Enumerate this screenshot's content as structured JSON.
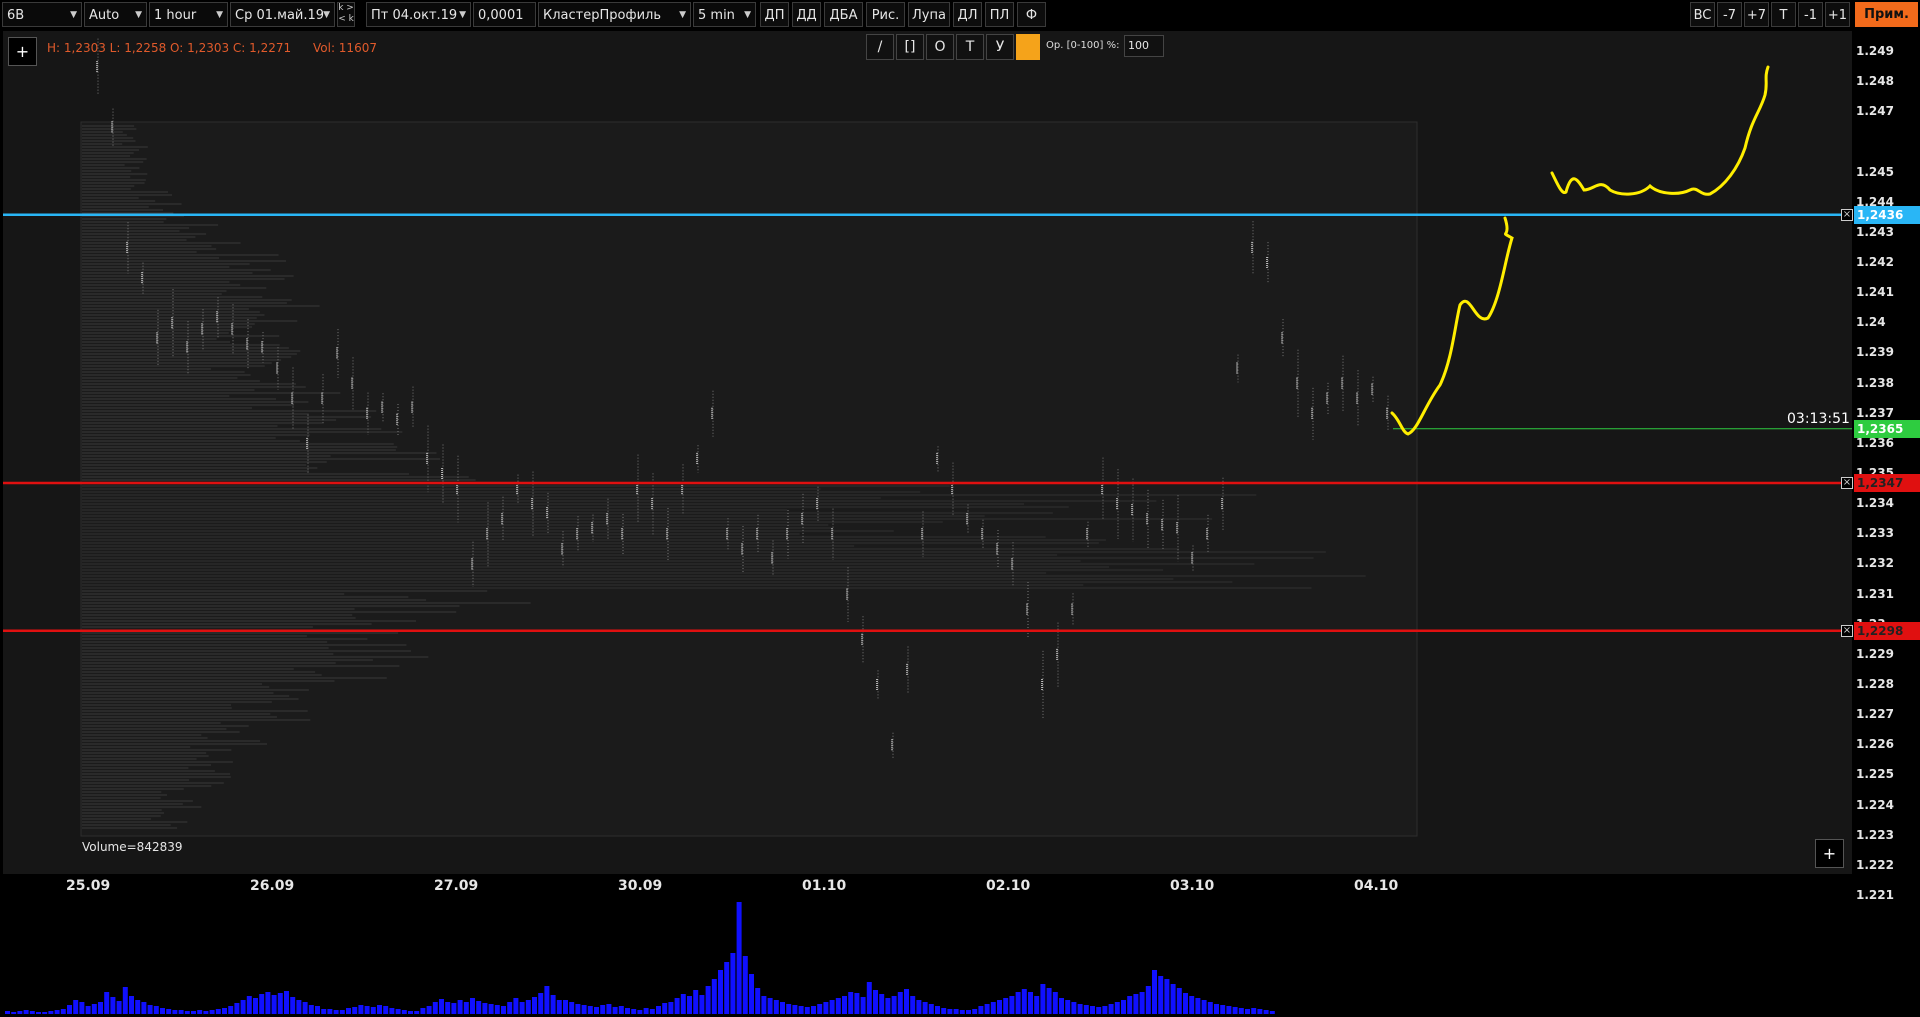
{
  "toolbar": {
    "symbol": "6B",
    "scale": "Auto",
    "timeframe": "1 hour",
    "date_from": "Ср 01.май.19",
    "k_top": "k >",
    "k_bottom": "< k",
    "date_to": "Пт 04.окт.19",
    "tick_size": "0,0001",
    "chart_type": "КластерПрофиль",
    "cluster_period": "5 min",
    "buttons": [
      "ДП",
      "ДД",
      "ДБА",
      "Рис.",
      "Лупа",
      "ДЛ",
      "ПЛ",
      "Ф"
    ],
    "right_buttons": [
      "BC",
      "-7",
      "+7",
      "T",
      "-1",
      "+1"
    ],
    "apply": "Прим."
  },
  "ohlc": "H: 1,2303  L: 1,2258  O: 1,2303  C: 1,2271",
  "vol": "Vol: 11607",
  "draw_tools": {
    "items": [
      "/",
      "[]",
      "O",
      "T",
      "У"
    ],
    "opacity_label": "Op. [0-100] %:",
    "opacity_value": "100",
    "color": "#f5a31a"
  },
  "volume_profile_label": "Volume=842839",
  "countdown": "03:13:51",
  "price_axis": {
    "ticks": [
      "1.249",
      "1.248",
      "1.247",
      "1.245",
      "1.244",
      "1.243",
      "1.242",
      "1.241",
      "1.24",
      "1.239",
      "1.238",
      "1.237",
      "1.236",
      "1.235",
      "1.234",
      "1.233",
      "1.232",
      "1.231",
      "1.23",
      "1.229",
      "1.228",
      "1.227",
      "1.226",
      "1.225",
      "1.224",
      "1.223",
      "1.222",
      "1.221"
    ],
    "labels": [
      {
        "text": "1,2436",
        "color": "#29b6f6"
      },
      {
        "text": "1,2365",
        "color": "#2ecc40"
      },
      {
        "text": "1,2347",
        "color": "#e01010"
      },
      {
        "text": "1,2298",
        "color": "#e01010"
      }
    ]
  },
  "date_axis": [
    "25.09",
    "26.09",
    "27.09",
    "30.09",
    "01.10",
    "02.10",
    "03.10",
    "04.10"
  ],
  "colors": {
    "blue_line": "#29b6f6",
    "red_line": "#e01010",
    "current_price": "#2ecc40",
    "drawing": "#ffee00",
    "volume_bars": "#1010ff"
  }
}
